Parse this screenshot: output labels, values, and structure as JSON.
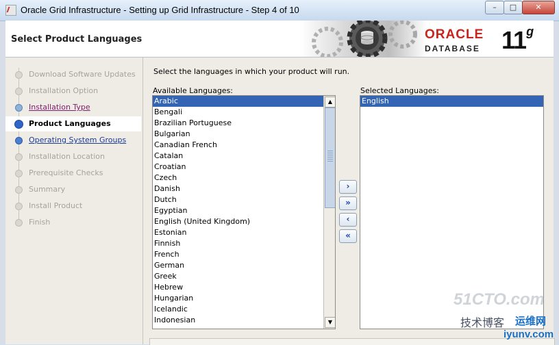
{
  "window": {
    "title": "Oracle Grid Infrastructure - Setting up Grid Infrastructure - Step 4 of 10",
    "minimize_glyph": "–",
    "maximize_glyph": "□",
    "close_glyph": "✕"
  },
  "header": {
    "page_title": "Select Product Languages",
    "logo_oracle": "ORACLE",
    "logo_database": "DATABASE",
    "logo_version": "11",
    "logo_version_suffix": "g"
  },
  "steps": [
    {
      "label": "Download Software Updates",
      "state": "disabled"
    },
    {
      "label": "Installation Option",
      "state": "disabled"
    },
    {
      "label": "Installation Type",
      "state": "done"
    },
    {
      "label": "Product Languages",
      "state": "active"
    },
    {
      "label": "Operating System Groups",
      "state": "link"
    },
    {
      "label": "Installation Location",
      "state": "disabled"
    },
    {
      "label": "Prerequisite Checks",
      "state": "disabled"
    },
    {
      "label": "Summary",
      "state": "disabled"
    },
    {
      "label": "Install Product",
      "state": "disabled"
    },
    {
      "label": "Finish",
      "state": "disabled"
    }
  ],
  "main": {
    "instruction": "Select the languages in which your product will run.",
    "available_label": "Available Languages:",
    "selected_label": "Selected Languages:",
    "available_languages": [
      "Arabic",
      "Bengali",
      "Brazilian Portuguese",
      "Bulgarian",
      "Canadian French",
      "Catalan",
      "Croatian",
      "Czech",
      "Danish",
      "Dutch",
      "Egyptian",
      "English (United Kingdom)",
      "Estonian",
      "Finnish",
      "French",
      "German",
      "Greek",
      "Hebrew",
      "Hungarian",
      "Icelandic",
      "Indonesian"
    ],
    "available_selected_index": 0,
    "selected_languages": [
      "English"
    ],
    "move_buttons": [
      {
        "glyph": "›",
        "name": "add-button"
      },
      {
        "glyph": "»",
        "name": "add-all-button"
      },
      {
        "glyph": "‹",
        "name": "remove-button"
      },
      {
        "glyph": "«",
        "name": "remove-all-button"
      }
    ],
    "scroll_up_glyph": "▲",
    "scroll_down_glyph": "▼"
  },
  "watermark": {
    "line1": "51CTO.com",
    "line2": "技术博客",
    "line3": "运维网",
    "line4": "iyunv.com"
  },
  "colors": {
    "accent_selection": "#3464b4",
    "oracle_red": "#c8251b",
    "active_step_dot": "#2f66c8",
    "done_step_link": "#7a1e6a",
    "link_blue": "#1c3b95"
  }
}
